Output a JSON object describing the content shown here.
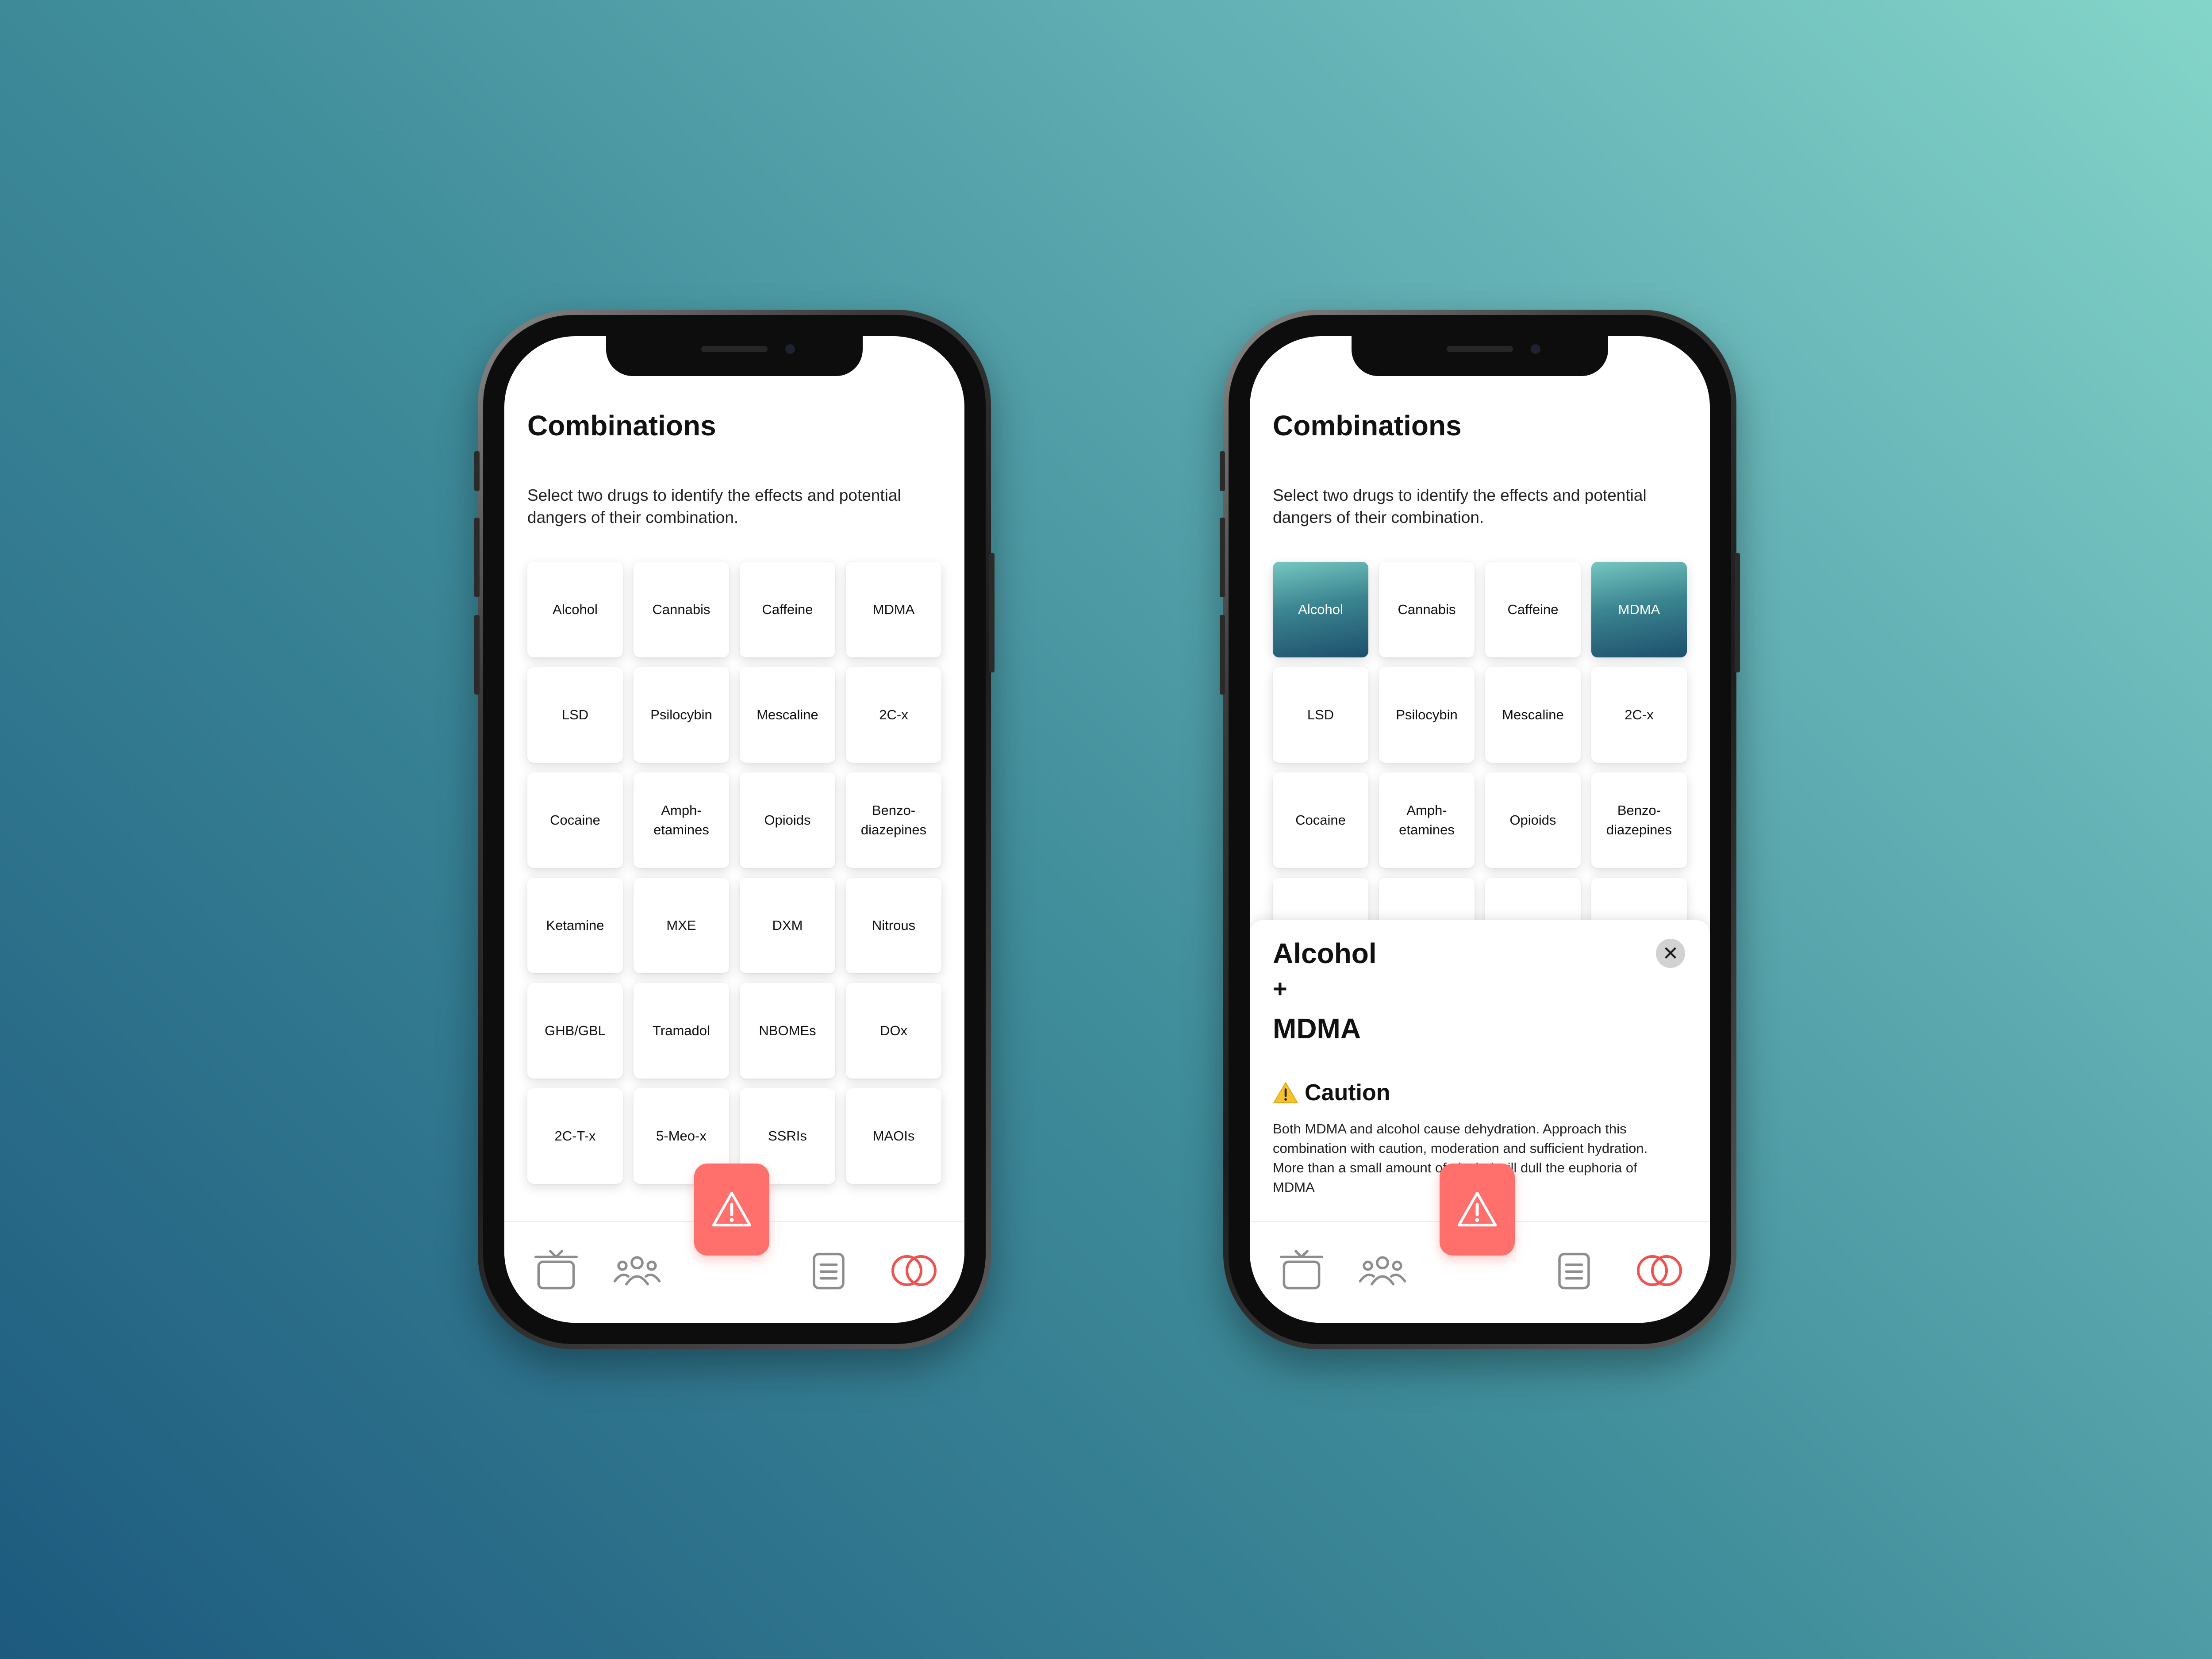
{
  "screens": [
    {
      "title": "Combinations",
      "subtitle": "Select two drugs to identify the effects and potential dangers of their combination.",
      "tiles": [
        "Alcohol",
        "Cannabis",
        "Caffeine",
        "MDMA",
        "LSD",
        "Psilocybin",
        "Mescaline",
        "2C-x",
        "Cocaine",
        "Amph-\netamines",
        "Opioids",
        "Benzo-\ndiazepines",
        "Ketamine",
        "MXE",
        "DXM",
        "Nitrous",
        "GHB/GBL",
        "Tramadol",
        "NBOMEs",
        "DOx",
        "2C-T-x",
        "5-Meo-x",
        "SSRIs",
        "MAOIs"
      ],
      "selected": []
    },
    {
      "title": "Combinations",
      "subtitle": "Select two drugs to identify the effects and potential dangers of their combination.",
      "tiles": [
        "Alcohol",
        "Cannabis",
        "Caffeine",
        "MDMA",
        "LSD",
        "Psilocybin",
        "Mescaline",
        "2C-x",
        "Cocaine",
        "Amph-\netamines",
        "Opioids",
        "Benzo-\ndiazepines",
        "",
        "",
        "",
        ""
      ],
      "selected": [
        "Alcohol",
        "MDMA"
      ],
      "sheet": {
        "drug_a": "Alcohol",
        "plus": "+",
        "drug_b": "MDMA",
        "level_label": "Caution",
        "level_icon": "warning-triangle-icon",
        "description": "Both MDMA and alcohol cause dehydration. Approach this combination with caution, moderation and sufficient hydration. More than a small amount of alcohol will dull the euphoria of MDMA",
        "close_icon": "close-icon"
      }
    }
  ],
  "tab_bar": {
    "icons": [
      "tv-icon",
      "people-icon",
      "alert-triangle-icon",
      "document-icon",
      "combinations-rings-icon"
    ],
    "active": "combinations-rings-icon"
  },
  "colors": {
    "alert": "#ff6f6b",
    "selected_start": "#76c7c0",
    "selected_end": "#1d4f6c",
    "background_start": "#1d5a7e",
    "background_end": "#84d5c9"
  }
}
